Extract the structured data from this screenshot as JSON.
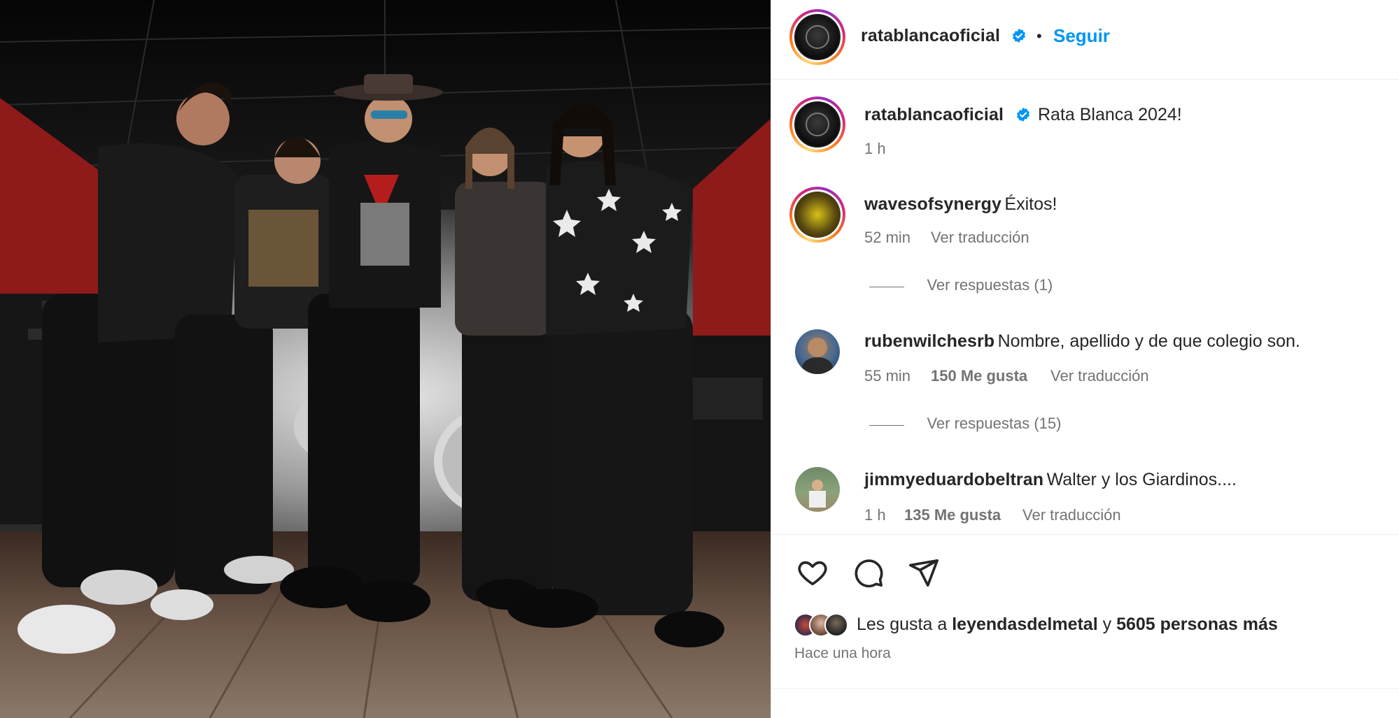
{
  "header": {
    "username": "ratablancaoficial",
    "separator": "•",
    "follow_label": "Seguir"
  },
  "caption": {
    "username": "ratablancaoficial",
    "text": "Rata Blanca 2024!",
    "time": "1 h"
  },
  "comments": [
    {
      "username": "wavesofsynergy",
      "text": "Éxitos!",
      "time": "52 min",
      "likes": "",
      "translate": "Ver traducción",
      "replies": "Ver respuestas (1)"
    },
    {
      "username": "rubenwilchesrb",
      "text": "Nombre, apellido y de que colegio son.",
      "time": "55 min",
      "likes": "150 Me gusta",
      "translate": "Ver traducción",
      "replies": "Ver respuestas (15)"
    },
    {
      "username": "jimmyeduardobeltran",
      "text": "Walter y los Giardinos....",
      "time": "1 h",
      "likes": "135 Me gusta",
      "translate": "Ver traducción",
      "replies": ""
    }
  ],
  "actions": {
    "like_icon": "heart-icon",
    "comment_icon": "comment-icon",
    "share_icon": "send-icon"
  },
  "likes": {
    "prefix": "Les gusta a",
    "user": "leyendasdelmetal",
    "connector": "y",
    "others": "5605 personas más"
  },
  "timestamp": "Hace una hora",
  "colors": {
    "link_blue": "#0095f6",
    "verified_blue": "#0095f6",
    "text_primary": "#262626",
    "text_secondary": "#737373"
  }
}
